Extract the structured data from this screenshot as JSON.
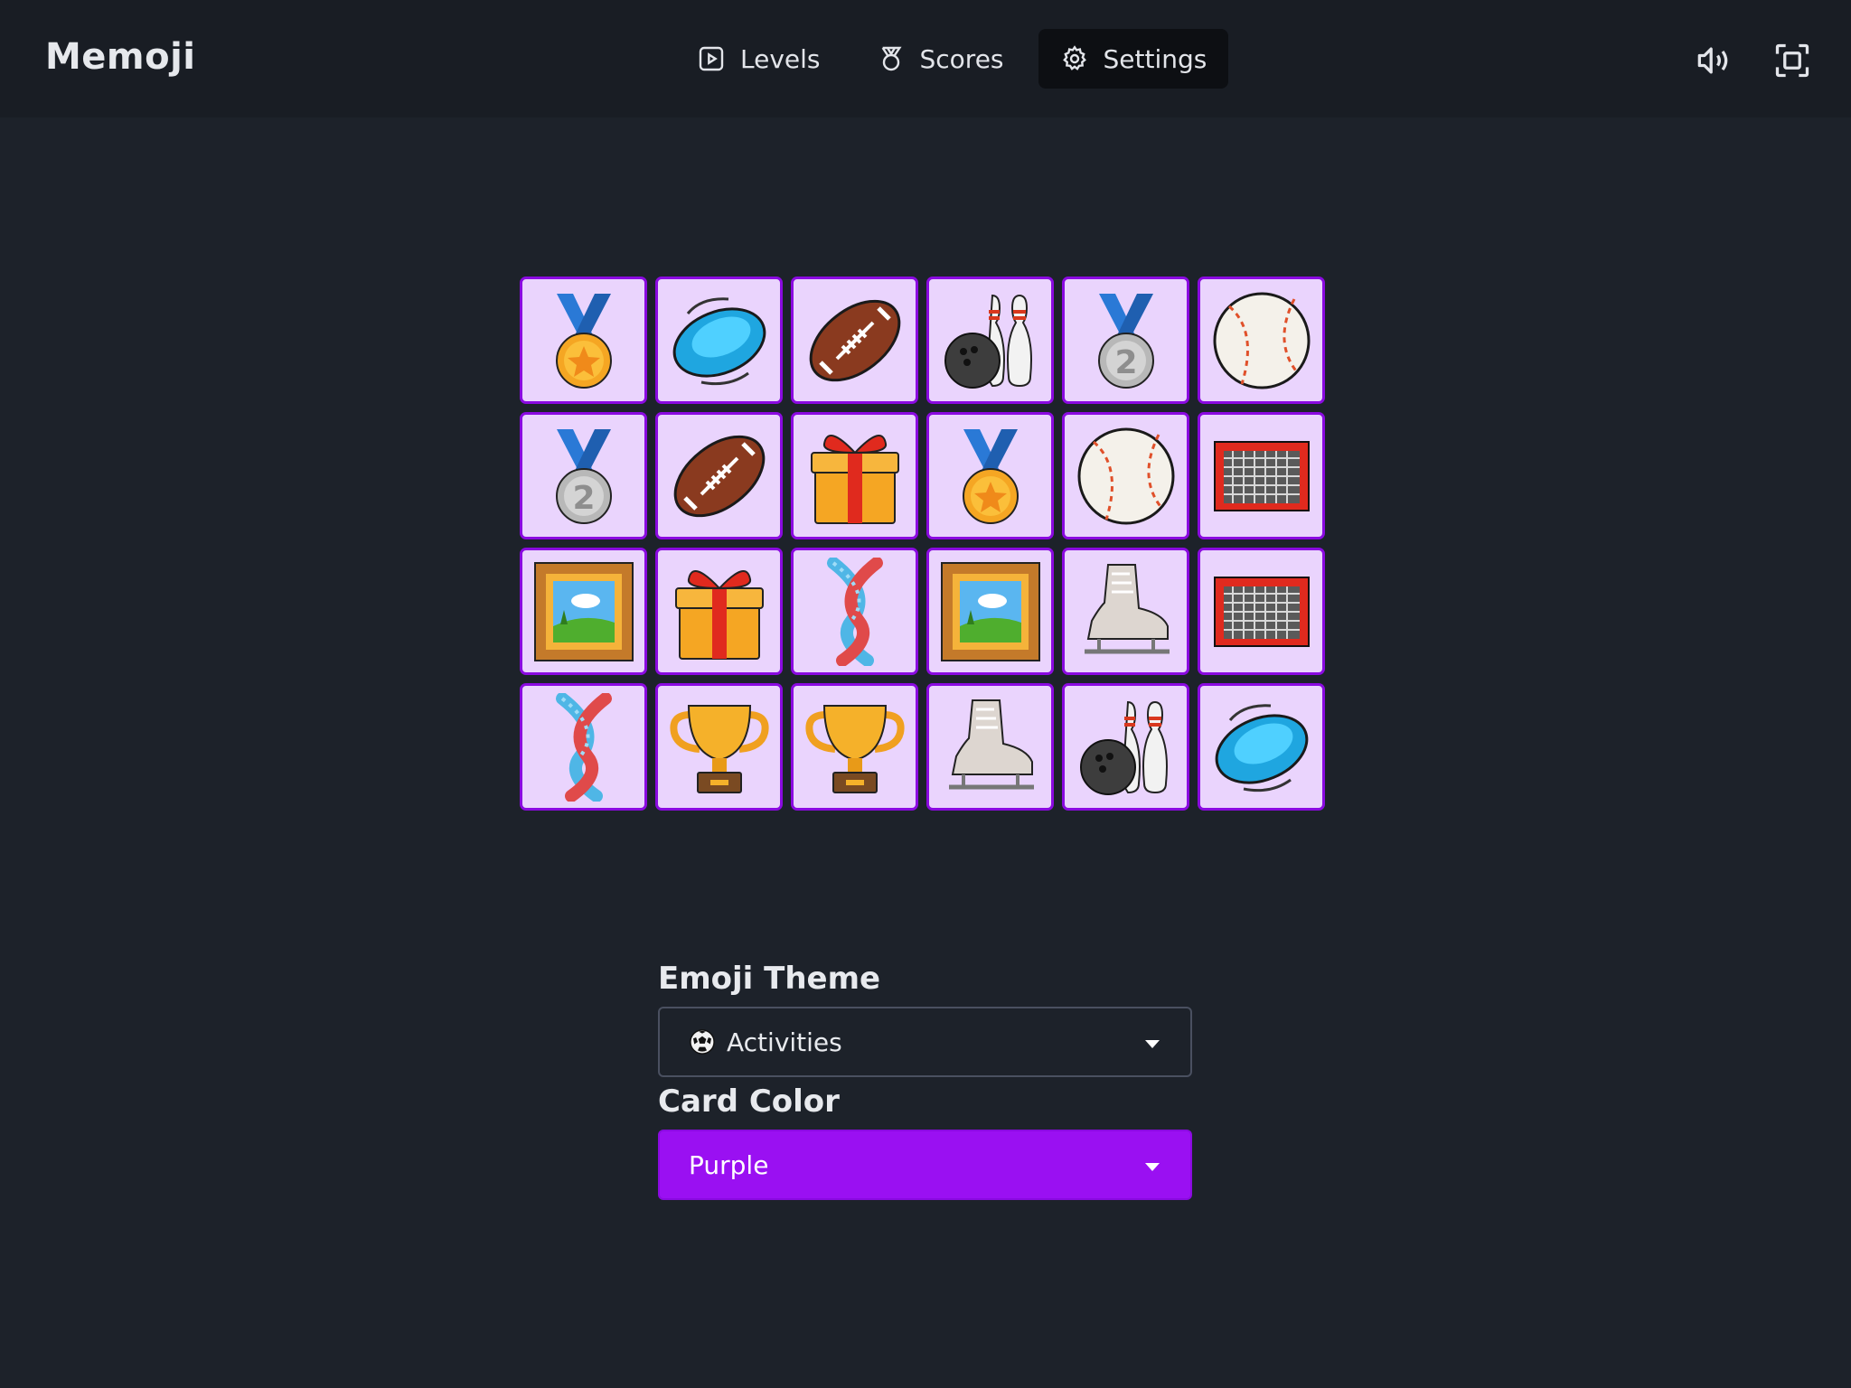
{
  "app": {
    "title": "Memoji"
  },
  "nav": {
    "levels_label": "Levels",
    "scores_label": "Scores",
    "settings_label": "Settings",
    "active": "settings"
  },
  "toolbar": {
    "sound_icon": "speaker-volume-icon",
    "fullscreen_icon": "fullscreen-icon"
  },
  "board": {
    "columns": 6,
    "rows": 4,
    "cards": [
      "medal-gold",
      "frisbee",
      "football",
      "bowling",
      "medal-silver",
      "baseball",
      "medal-silver",
      "football",
      "gift",
      "medal-gold",
      "baseball",
      "goal-net",
      "framed-picture",
      "gift",
      "knot",
      "framed-picture",
      "ice-skate",
      "goal-net",
      "knot",
      "trophy",
      "trophy",
      "ice-skate",
      "bowling",
      "frisbee"
    ]
  },
  "settings": {
    "theme_label": "Emoji Theme",
    "theme_value": "Activities",
    "theme_icon": "soccer-ball-icon",
    "color_label": "Card Color",
    "color_value": "Purple"
  },
  "colors": {
    "background": "#1d222a",
    "topbar": "#191d24",
    "card_face": "#ead4fd",
    "card_border": "#8a0ae0",
    "accent_purple": "#9a10f2"
  }
}
